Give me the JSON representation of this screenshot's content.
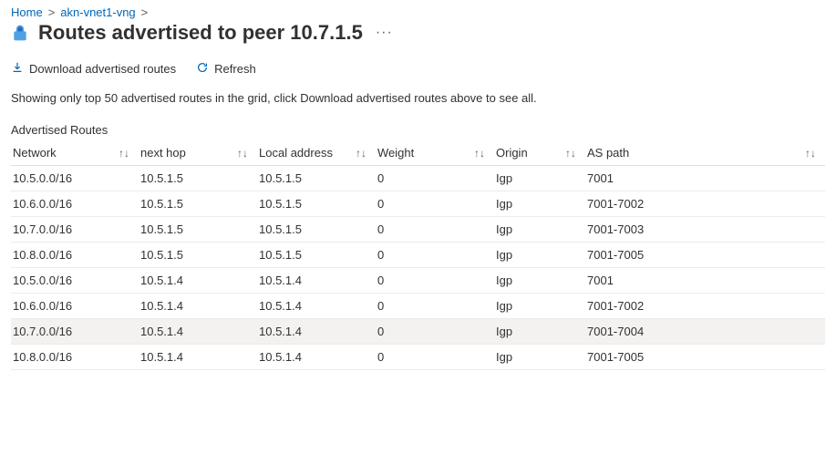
{
  "breadcrumb": {
    "items": [
      {
        "label": "Home"
      },
      {
        "label": "akn-vnet1-vng"
      }
    ],
    "sep": ">"
  },
  "header": {
    "title": "Routes advertised to peer 10.7.1.5",
    "more": "···"
  },
  "toolbar": {
    "download_label": "Download advertised routes",
    "refresh_label": "Refresh"
  },
  "note": "Showing only top 50 advertised routes in the grid, click Download advertised routes above to see all.",
  "section": {
    "label": "Advertised Routes"
  },
  "table": {
    "sort_glyph": "↑↓",
    "columns": {
      "network": "Network",
      "nexthop": "next hop",
      "localaddr": "Local address",
      "weight": "Weight",
      "origin": "Origin",
      "aspath": "AS path"
    },
    "rows": [
      {
        "network": "10.5.0.0/16",
        "nexthop": "10.5.1.5",
        "localaddr": "10.5.1.5",
        "weight": "0",
        "origin": "Igp",
        "aspath": "7001",
        "highlight": false
      },
      {
        "network": "10.6.0.0/16",
        "nexthop": "10.5.1.5",
        "localaddr": "10.5.1.5",
        "weight": "0",
        "origin": "Igp",
        "aspath": "7001-7002",
        "highlight": false
      },
      {
        "network": "10.7.0.0/16",
        "nexthop": "10.5.1.5",
        "localaddr": "10.5.1.5",
        "weight": "0",
        "origin": "Igp",
        "aspath": "7001-7003",
        "highlight": false
      },
      {
        "network": "10.8.0.0/16",
        "nexthop": "10.5.1.5",
        "localaddr": "10.5.1.5",
        "weight": "0",
        "origin": "Igp",
        "aspath": "7001-7005",
        "highlight": false
      },
      {
        "network": "10.5.0.0/16",
        "nexthop": "10.5.1.4",
        "localaddr": "10.5.1.4",
        "weight": "0",
        "origin": "Igp",
        "aspath": "7001",
        "highlight": false
      },
      {
        "network": "10.6.0.0/16",
        "nexthop": "10.5.1.4",
        "localaddr": "10.5.1.4",
        "weight": "0",
        "origin": "Igp",
        "aspath": "7001-7002",
        "highlight": false
      },
      {
        "network": "10.7.0.0/16",
        "nexthop": "10.5.1.4",
        "localaddr": "10.5.1.4",
        "weight": "0",
        "origin": "Igp",
        "aspath": "7001-7004",
        "highlight": true
      },
      {
        "network": "10.8.0.0/16",
        "nexthop": "10.5.1.4",
        "localaddr": "10.5.1.4",
        "weight": "0",
        "origin": "Igp",
        "aspath": "7001-7005",
        "highlight": false
      }
    ]
  }
}
